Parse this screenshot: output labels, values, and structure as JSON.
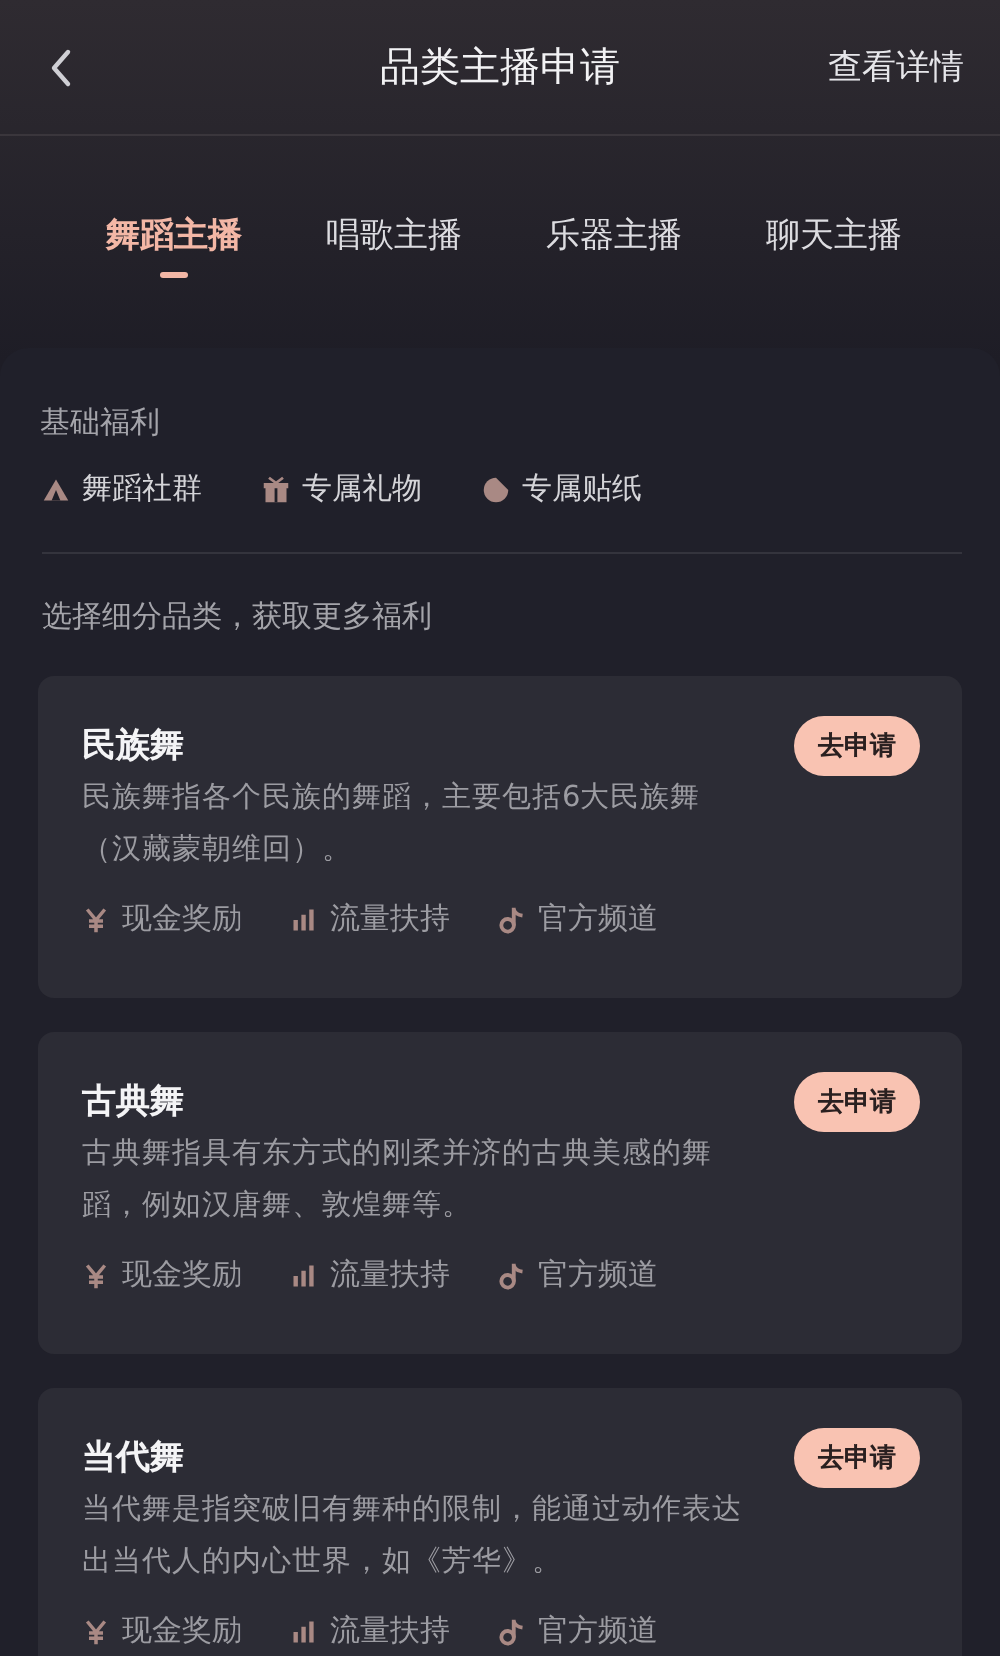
{
  "nav": {
    "title": "品类主播申请",
    "action": "查看详情"
  },
  "tabs": [
    {
      "label": "舞蹈主播",
      "selected": true
    },
    {
      "label": "唱歌主播",
      "selected": false
    },
    {
      "label": "乐器主播",
      "selected": false
    },
    {
      "label": "聊天主播",
      "selected": false
    }
  ],
  "basic_benefits": {
    "heading": "基础福利",
    "items": [
      {
        "kind": "community",
        "label": "舞蹈社群"
      },
      {
        "kind": "gift",
        "label": "专属礼物"
      },
      {
        "kind": "sticker",
        "label": "专属贴纸"
      }
    ]
  },
  "subcategory_hint": "选择细分品类，获取更多福利",
  "categories": [
    {
      "title": "民族舞",
      "description": "民族舞指各个民族的舞蹈，主要包括6大民族舞（汉藏蒙朝维回）。",
      "button": "去申请",
      "perks": [
        {
          "kind": "cash",
          "label": "现金奖励"
        },
        {
          "kind": "traffic",
          "label": "流量扶持"
        },
        {
          "kind": "channel",
          "label": "官方频道"
        }
      ]
    },
    {
      "title": "古典舞",
      "description": "古典舞指具有东方式的刚柔并济的古典美感的舞蹈，例如汉唐舞、敦煌舞等。",
      "button": "去申请",
      "perks": [
        {
          "kind": "cash",
          "label": "现金奖励"
        },
        {
          "kind": "traffic",
          "label": "流量扶持"
        },
        {
          "kind": "channel",
          "label": "官方频道"
        }
      ]
    },
    {
      "title": "当代舞",
      "description": "当代舞是指突破旧有舞种的限制，能通过动作表达出当代人的内心世界，如《芳华》。",
      "button": "去申请",
      "perks": [
        {
          "kind": "cash",
          "label": "现金奖励"
        },
        {
          "kind": "traffic",
          "label": "流量扶持"
        },
        {
          "kind": "channel",
          "label": "官方频道"
        }
      ]
    }
  ]
}
